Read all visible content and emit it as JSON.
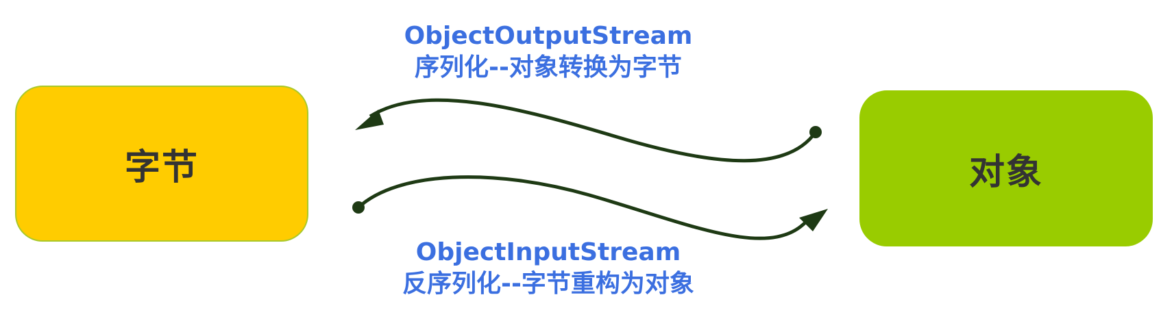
{
  "boxes": {
    "bytes": {
      "label": "字节",
      "color": "#ffcc00"
    },
    "object": {
      "label": "对象",
      "color": "#99cc00"
    }
  },
  "serialize": {
    "class_name": "ObjectOutputStream",
    "description": "序列化--对象转换为字节"
  },
  "deserialize": {
    "class_name": "ObjectInputStream",
    "description": "反序列化--字节重构为对象"
  },
  "colors": {
    "caption_text": "#3b6fe0",
    "arrow": "#1e3a14",
    "box_text": "#333333"
  }
}
